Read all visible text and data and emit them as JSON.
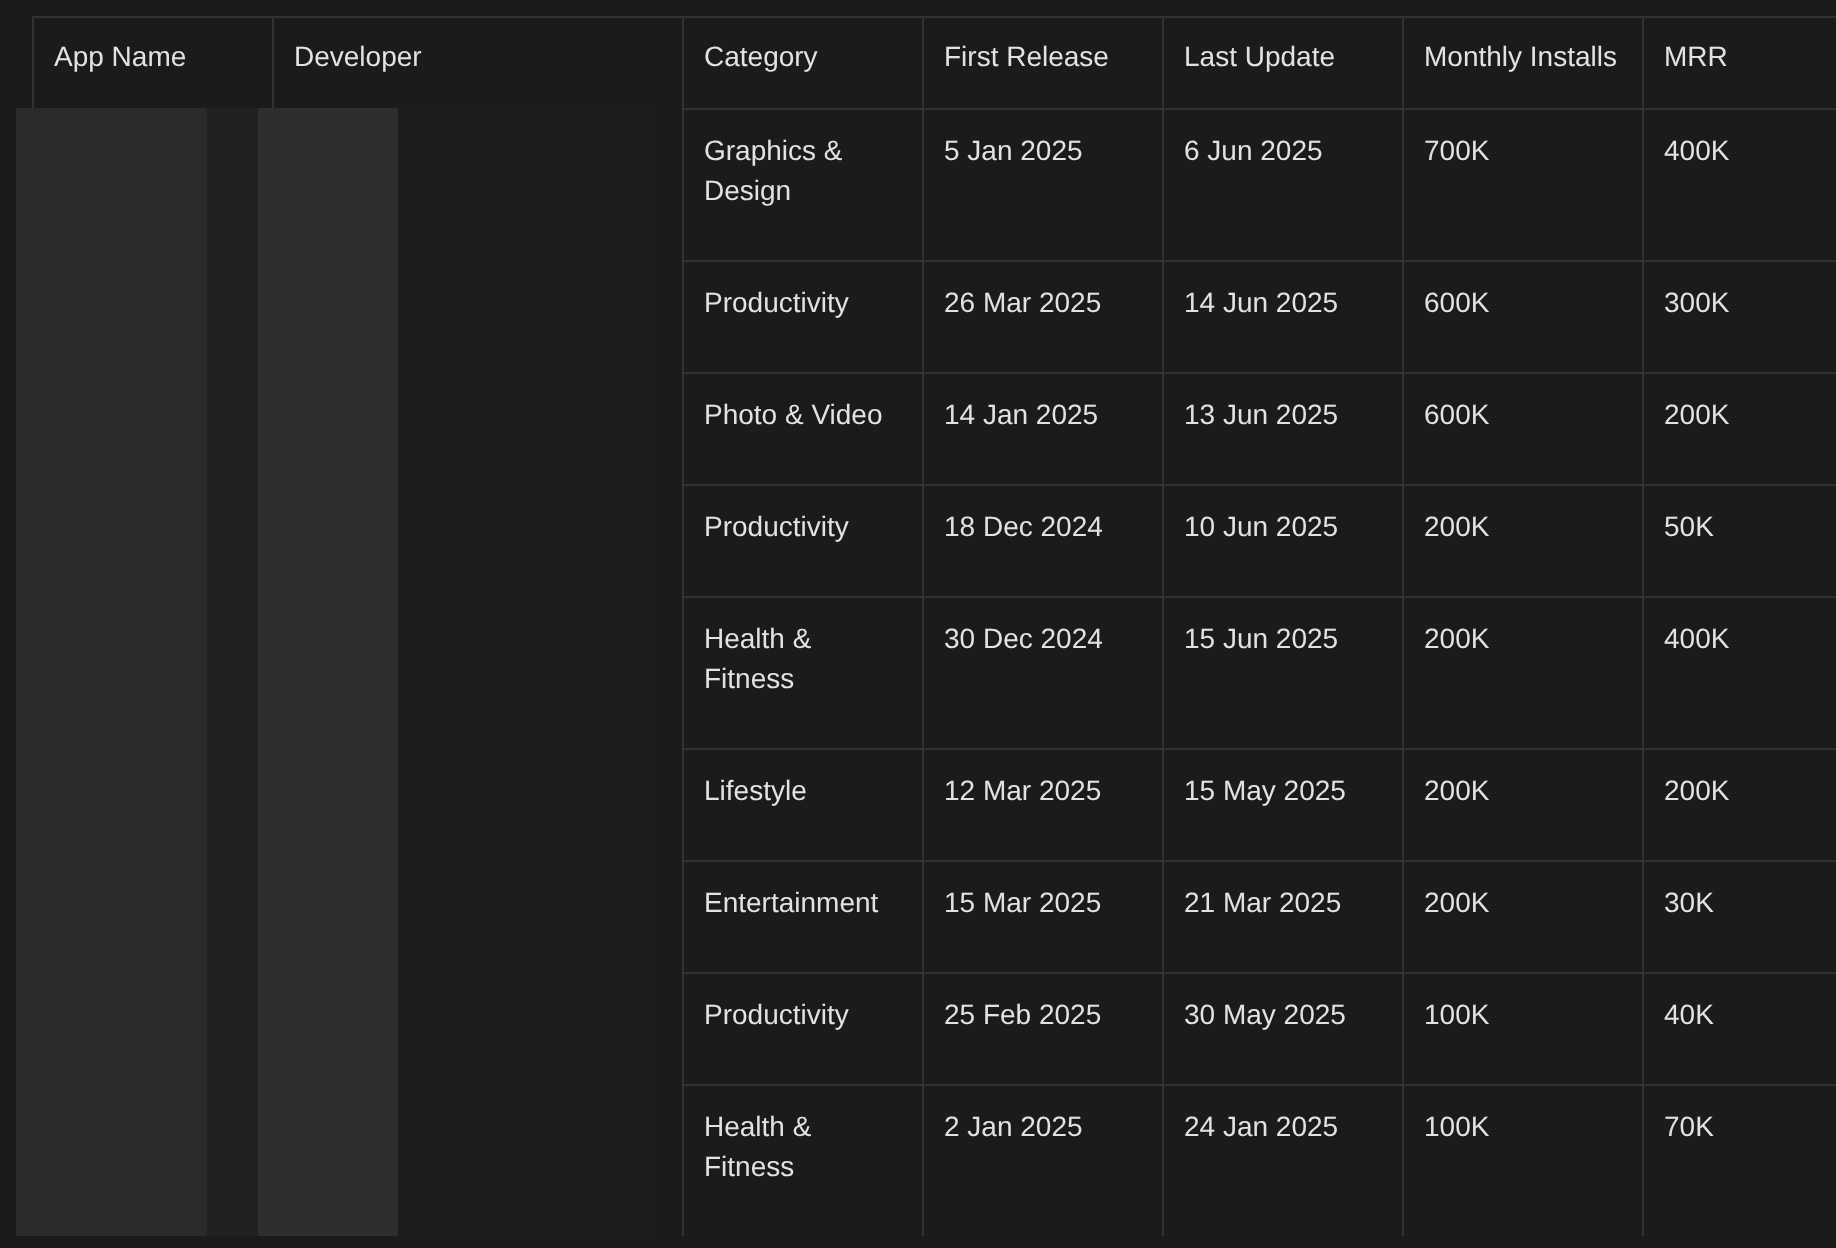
{
  "table": {
    "columns": [
      "App Name",
      "Developer",
      "Category",
      "First Release",
      "Last Update",
      "Monthly Installs",
      "MRR"
    ],
    "rows": [
      {
        "category": "Graphics & Design",
        "first_release": "5 Jan 2025",
        "last_update": "6 Jun 2025",
        "monthly_installs": "700K",
        "mrr": "400K"
      },
      {
        "category": "Productivity",
        "first_release": "26 Mar 2025",
        "last_update": "14 Jun 2025",
        "monthly_installs": "600K",
        "mrr": "300K"
      },
      {
        "category": "Photo & Video",
        "first_release": "14 Jan 2025",
        "last_update": "13 Jun 2025",
        "monthly_installs": "600K",
        "mrr": "200K"
      },
      {
        "category": "Productivity",
        "first_release": "18 Dec 2024",
        "last_update": "10 Jun 2025",
        "monthly_installs": "200K",
        "mrr": "50K"
      },
      {
        "category": "Health & Fitness",
        "first_release": "30 Dec 2024",
        "last_update": "15 Jun 2025",
        "monthly_installs": "200K",
        "mrr": "400K"
      },
      {
        "category": "Lifestyle",
        "first_release": "12 Mar 2025",
        "last_update": "15 May 2025",
        "monthly_installs": "200K",
        "mrr": "200K"
      },
      {
        "category": "Entertainment",
        "first_release": "15 Mar 2025",
        "last_update": "21 Mar 2025",
        "monthly_installs": "200K",
        "mrr": "30K"
      },
      {
        "category": "Productivity",
        "first_release": "25 Feb 2025",
        "last_update": "30 May 2025",
        "monthly_installs": "100K",
        "mrr": "40K"
      },
      {
        "category": "Health & Fitness",
        "first_release": "2 Jan 2025",
        "last_update": "24 Jan 2025",
        "monthly_installs": "100K",
        "mrr": "70K"
      }
    ]
  }
}
